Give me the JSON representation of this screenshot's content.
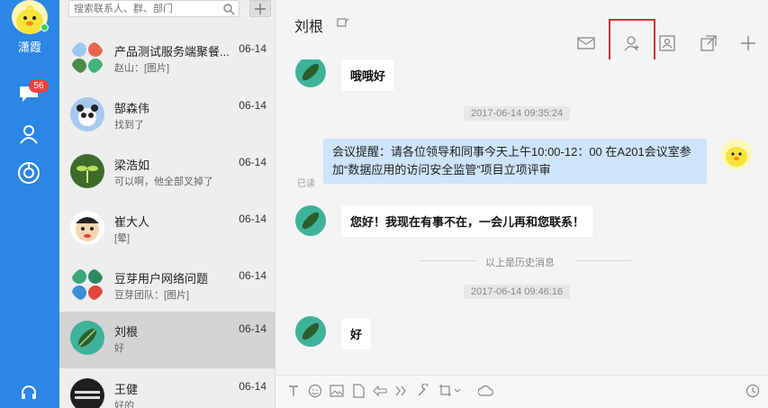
{
  "user": {
    "name": "潇霞"
  },
  "nav": {
    "unread_badge": "56",
    "items": [
      "chat-icon",
      "contacts-icon",
      "apps-icon",
      "headset-icon"
    ]
  },
  "search": {
    "placeholder": "搜索联系人、群、部门"
  },
  "conversations": [
    {
      "name": "产品测试服务端聚餐...",
      "time": "06-14",
      "preview": "赵山：[图片]",
      "avatar": "group-avatar"
    },
    {
      "name": "郜森伟",
      "time": "06-14",
      "preview": "找到了",
      "avatar": "panda-avatar"
    },
    {
      "name": "梁浩如",
      "time": "06-14",
      "preview": "可以啊，他全部叉掉了",
      "avatar": "sprout-avatar"
    },
    {
      "name": "崔大人",
      "time": "06-14",
      "preview": "[晕]",
      "avatar": "cartoon-avatar"
    },
    {
      "name": "豆芽用户网络问题",
      "time": "06-14",
      "preview": "豆芽团队：[图片]",
      "avatar": "group-avatar"
    },
    {
      "name": "刘根",
      "time": "06-14",
      "preview": "好",
      "avatar": "leaf-avatar",
      "active": true
    },
    {
      "name": "王健",
      "time": "06-14",
      "preview": "好的",
      "avatar": "text-avatar"
    }
  ],
  "chat": {
    "title": "刘根",
    "messages": [
      {
        "type": "in",
        "text": "哦哦好"
      },
      {
        "type": "time",
        "text": "2017-06-14 09:35:24"
      },
      {
        "type": "out",
        "text": "会议提醒：请各位领导和同事今天上午10:00-12：00 在A201会议室参加“数据应用的访问安全监管”项目立项评审",
        "status": "已读"
      },
      {
        "type": "in",
        "text": "您好！我现在有事不在，一会儿再和您联系！"
      },
      {
        "type": "divider",
        "text": "以上是历史消息"
      },
      {
        "type": "time",
        "text": "2017-06-14 09:46:16"
      },
      {
        "type": "in",
        "text": "好"
      }
    ]
  },
  "colors": {
    "nav_bg": "#2b86e6",
    "badge": "#f04141",
    "highlight": "#c0393b",
    "my_bubble": "#cde4fb"
  }
}
